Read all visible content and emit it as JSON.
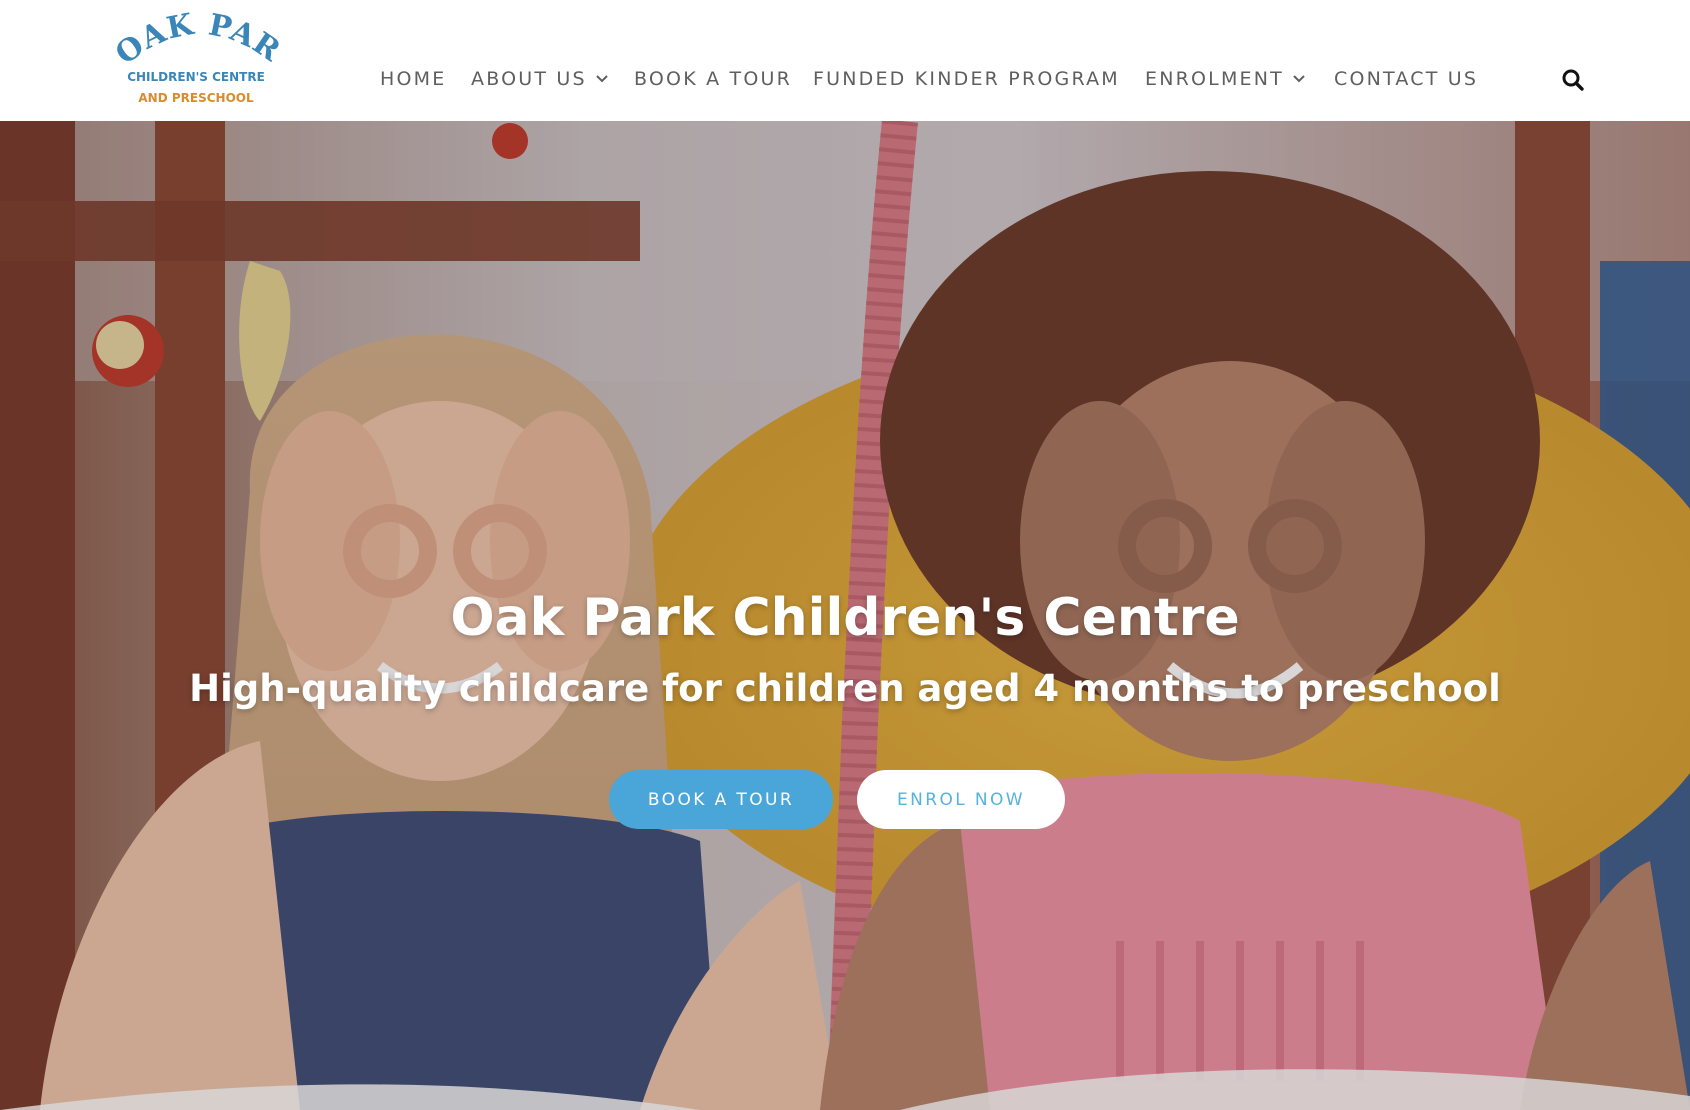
{
  "brand": {
    "logo_line1": "OAK PARK",
    "logo_line2": "CHILDREN'S CENTRE",
    "logo_line3": "AND PRESCHOOL",
    "logo_colors": {
      "arc": "#3a86b8",
      "accent": "#d98c2a"
    }
  },
  "nav": {
    "items": [
      {
        "label": "HOME",
        "has_dropdown": false
      },
      {
        "label": "ABOUT US",
        "has_dropdown": true
      },
      {
        "label": "BOOK A TOUR",
        "has_dropdown": false
      },
      {
        "label": "FUNDED KINDER PROGRAM",
        "has_dropdown": false
      },
      {
        "label": "ENROLMENT",
        "has_dropdown": true
      },
      {
        "label": "CONTACT US",
        "has_dropdown": false
      }
    ],
    "search_icon": "search-icon",
    "dropdown_icon": "chevron-down-icon"
  },
  "hero": {
    "title": "Oak Park Children's Centre",
    "subtitle": "High-quality childcare for children aged 4 months to preschool",
    "primary_button": "BOOK A TOUR",
    "secondary_button": "ENROL NOW",
    "image": "two-children-making-glasses-gesture"
  },
  "colors": {
    "accent_blue": "#4aa6d8",
    "nav_text": "#5f5f5f",
    "white": "#ffffff"
  }
}
